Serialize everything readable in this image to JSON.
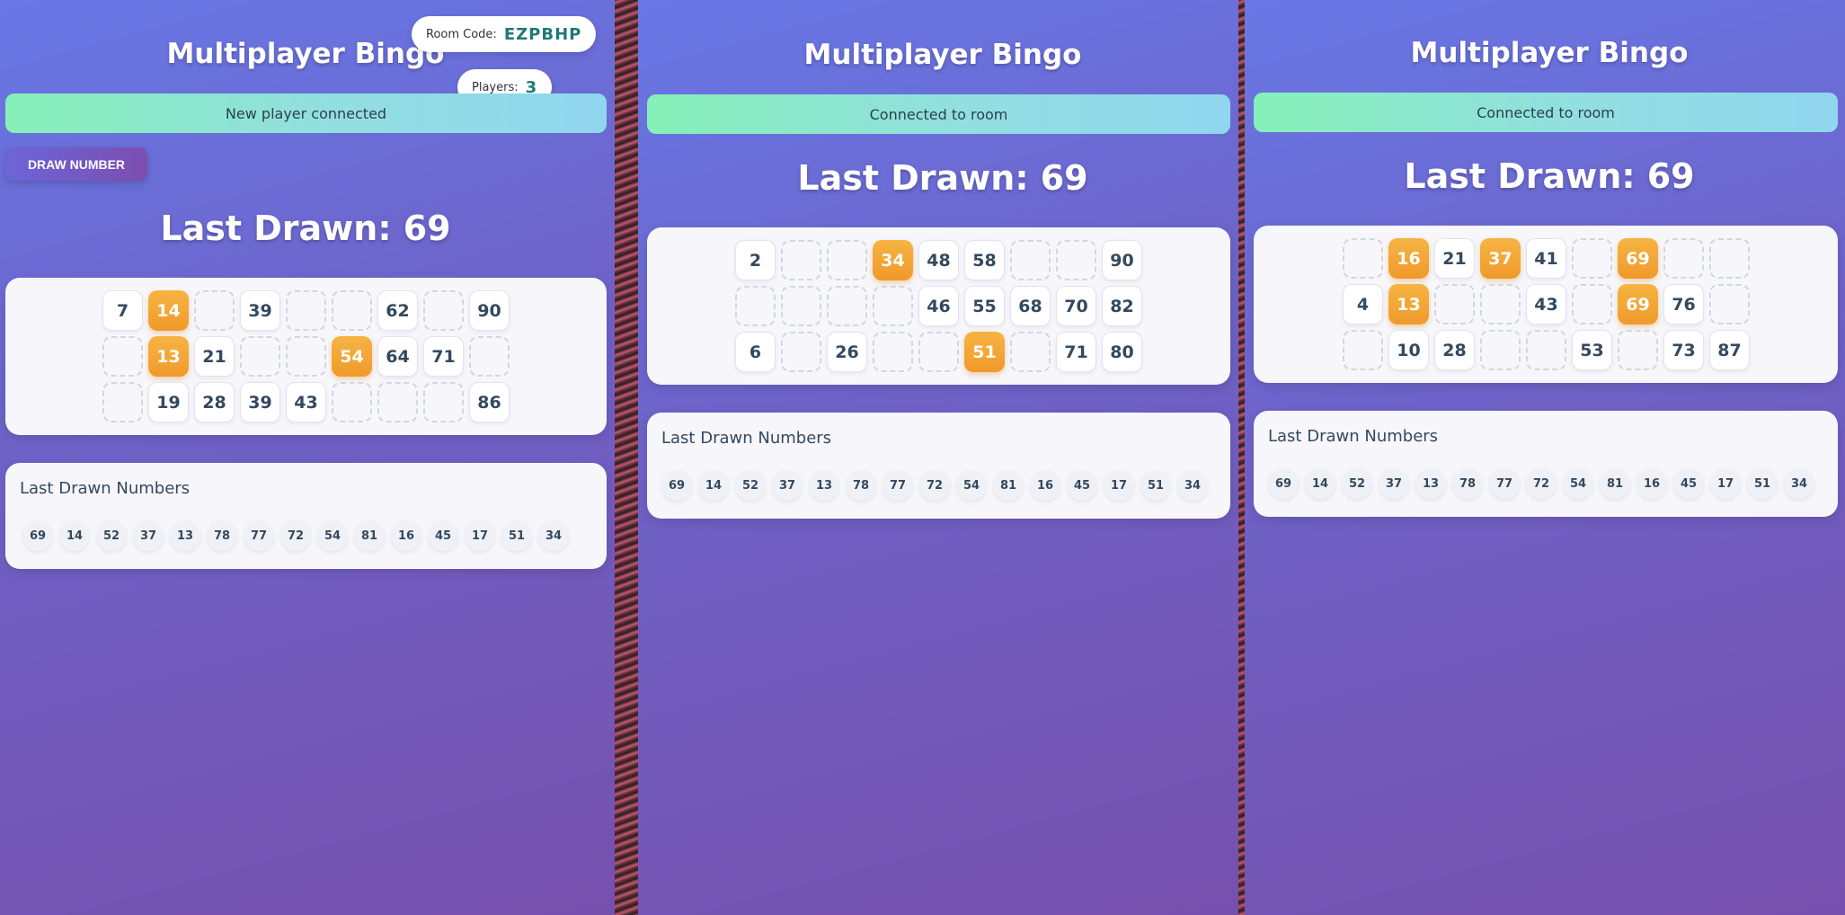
{
  "app_title": "Multiplayer Bingo",
  "host_panel": {
    "room_code_label": "Room Code:",
    "room_code": "EZPBHP",
    "players_label": "Players:",
    "players_count": "3",
    "status": "New player connected",
    "draw_button": "DRAW NUMBER",
    "last_drawn": "Last Drawn: 69",
    "card": [
      [
        "7",
        "14",
        "",
        "39",
        "",
        "",
        "62",
        "",
        "90"
      ],
      [
        "",
        "13",
        "21",
        "",
        "",
        "54",
        "64",
        "71",
        ""
      ],
      [
        "",
        "19",
        "28",
        "39",
        "43",
        "",
        "",
        "",
        "86"
      ]
    ],
    "marked": [
      "0-1",
      "1-1",
      "1-5"
    ]
  },
  "player2_panel": {
    "status": "Connected to room",
    "last_drawn": "Last Drawn: 69",
    "card": [
      [
        "2",
        "",
        "",
        "34",
        "48",
        "58",
        "",
        "",
        "90"
      ],
      [
        "",
        "",
        "",
        "",
        "46",
        "55",
        "68",
        "70",
        "82"
      ],
      [
        "6",
        "",
        "26",
        "",
        "",
        "51",
        "",
        "71",
        "80"
      ]
    ],
    "marked": [
      "0-3",
      "2-5"
    ]
  },
  "player3_panel": {
    "status": "Connected to room",
    "last_drawn": "Last Drawn: 69",
    "card": [
      [
        "",
        "16",
        "21",
        "37",
        "41",
        "",
        "69",
        "",
        ""
      ],
      [
        "4",
        "13",
        "",
        "",
        "43",
        "",
        "69",
        "76",
        ""
      ],
      [
        "",
        "10",
        "28",
        "",
        "",
        "53",
        "",
        "73",
        "87"
      ]
    ],
    "marked": [
      "0-1",
      "0-3",
      "0-6",
      "1-1",
      "1-6"
    ]
  },
  "history_title": "Last Drawn Numbers",
  "history": [
    "69",
    "14",
    "52",
    "37",
    "13",
    "78",
    "77",
    "72",
    "54",
    "81",
    "16",
    "45",
    "17",
    "51",
    "34"
  ],
  "colors": {
    "marked": "#f0a030",
    "status_start": "#86f0b8",
    "status_end": "#8fd6ee",
    "bg_start": "#6878e6",
    "bg_end": "#7650ad"
  }
}
